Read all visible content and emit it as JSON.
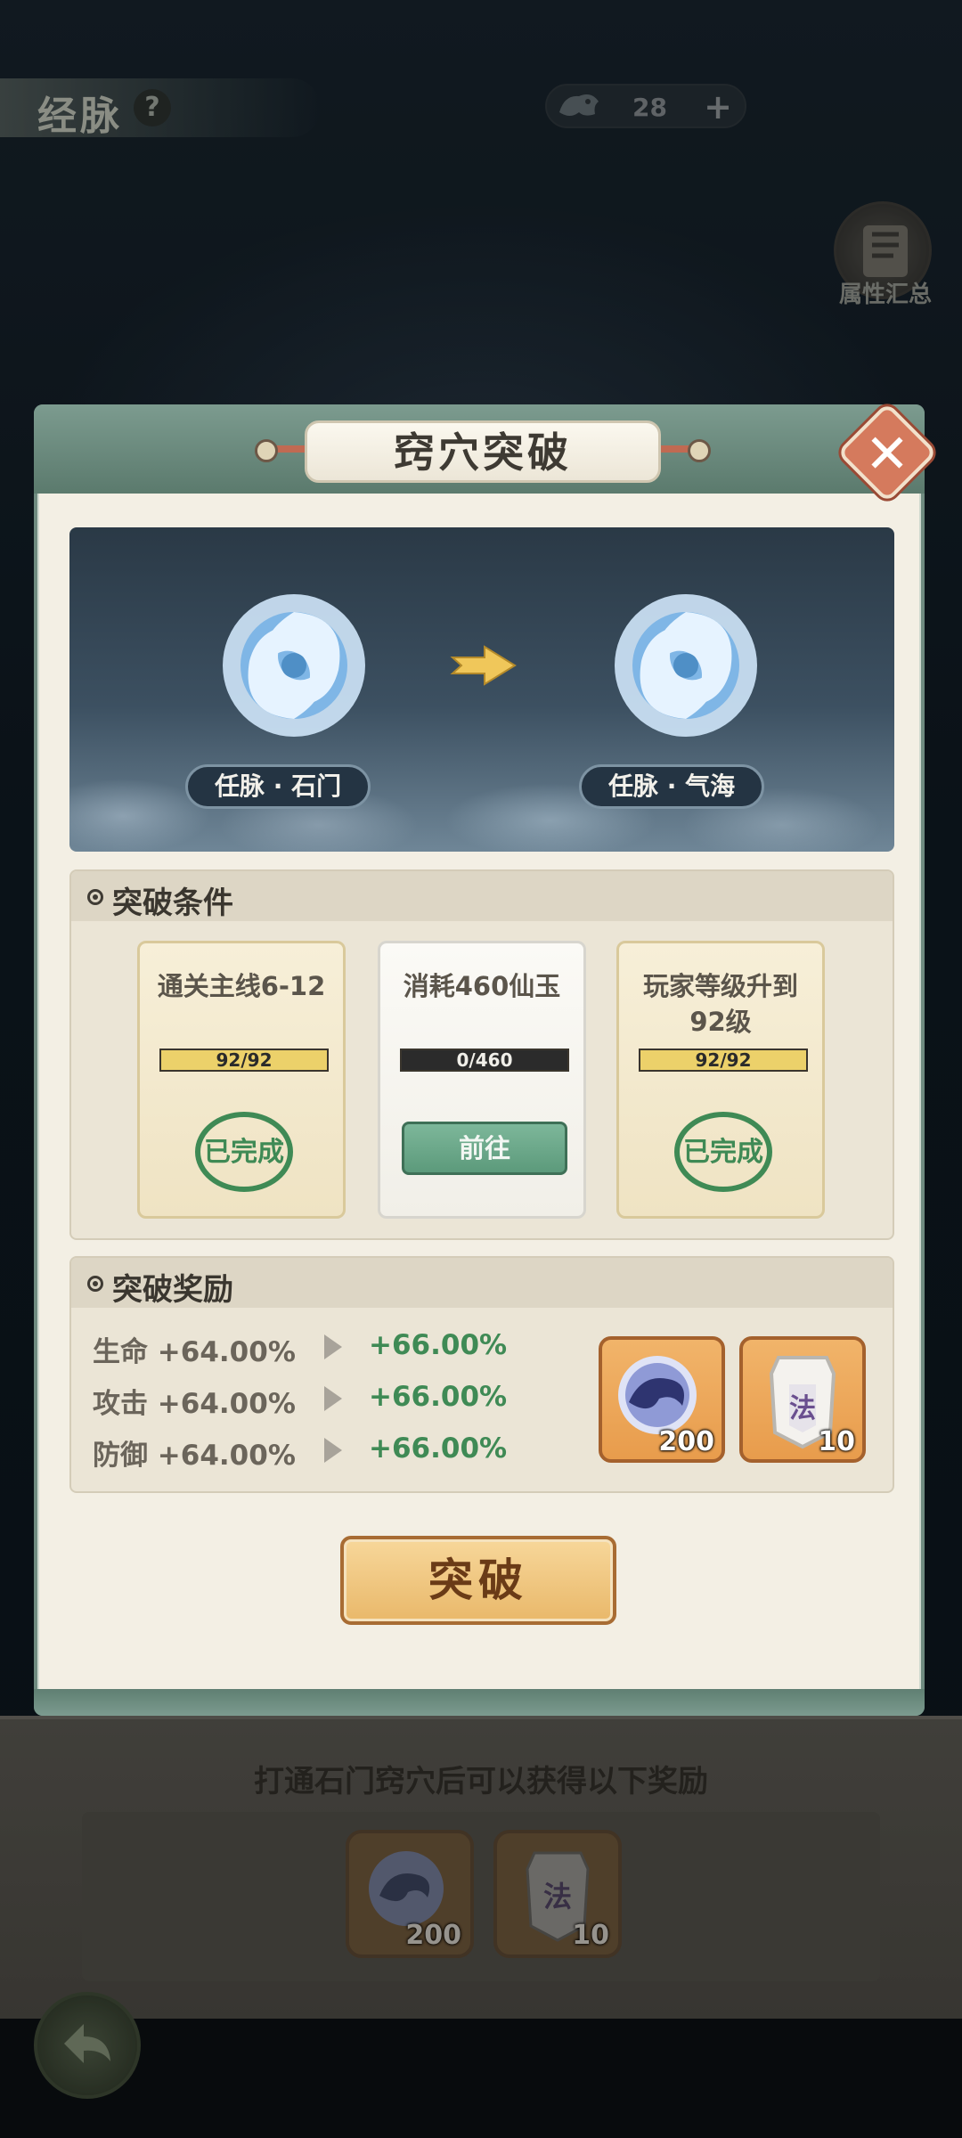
{
  "page": {
    "title": "经脉",
    "help_icon": "?",
    "currency": {
      "value": "28",
      "plus": "+"
    },
    "attr_summary_label": "属性汇总"
  },
  "modal": {
    "title": "窍穴突破",
    "close": "✕",
    "from_node": "任脉 · 石门",
    "to_node": "任脉 · 气海",
    "conditions": {
      "heading": "突破条件",
      "cards": [
        {
          "title": "通关主线6-12",
          "progress": "92/92",
          "fraction": 1.0,
          "status": "已完成"
        },
        {
          "title": "消耗460仙玉",
          "progress": "0/460",
          "fraction": 0.0,
          "action": "前往"
        },
        {
          "title": "玩家等级升到92级",
          "progress": "92/92",
          "fraction": 1.0,
          "status": "已完成"
        }
      ]
    },
    "rewards": {
      "heading": "突破奖励",
      "stats": [
        {
          "label": "生命 +64.00%",
          "new": "+66.00%"
        },
        {
          "label": "攻击 +64.00%",
          "new": "+66.00%"
        },
        {
          "label": "防御 +64.00%",
          "new": "+66.00%"
        }
      ],
      "items": [
        {
          "icon": "spirit-jade-icon",
          "count": "200"
        },
        {
          "icon": "fa-talisman-icon",
          "glyph": "法",
          "count": "10"
        }
      ]
    },
    "break_button": "突破"
  },
  "bottom": {
    "message": "打通石门窍穴后可以获得以下奖励",
    "items": [
      {
        "icon": "spirit-jade-icon",
        "count": "200"
      },
      {
        "icon": "fa-talisman-icon",
        "glyph": "法",
        "count": "10"
      }
    ]
  },
  "colors": {
    "accent_green": "#3f8a55",
    "button_orange": "#e9b86a",
    "close_red": "#d57a5d",
    "progress_gold": "#ecd16a"
  }
}
